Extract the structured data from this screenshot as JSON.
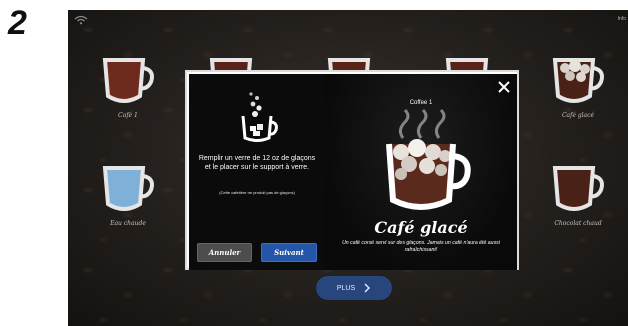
{
  "step_number": "2",
  "screen": {
    "top_right_label": "Info",
    "background_items": [
      {
        "label": "Café 1",
        "fill": "#6e2a1d"
      },
      {
        "label": "Café glacé",
        "fill": "#d9d2cb"
      },
      {
        "label": "Eau chaude",
        "fill": "#7fb0d8"
      },
      {
        "label": "Chocolat chaud",
        "fill": "#4a2116"
      }
    ],
    "plus_button": {
      "label": "PLUS",
      "icon": "chevron-right-icon"
    }
  },
  "dialog": {
    "instruction": "Remplir un verre de 12 oz de glaçons et le placer sur le support à verre.",
    "note": "(Cette cafetière ne produit pas de glaçons)",
    "cancel_label": "Annuler",
    "next_label": "Suivant",
    "coffee_number": "Coffee 1",
    "drink_name": "Café glacé",
    "drink_description": "Un café corsé servi sur des glaçons. Jamais un café n'aura été aussi rafraîchissant!",
    "close_icon": "close-icon"
  },
  "colors": {
    "accent": "#2355a8",
    "plus_button": "#27467e",
    "cancel_button": "#4d4d4d"
  }
}
